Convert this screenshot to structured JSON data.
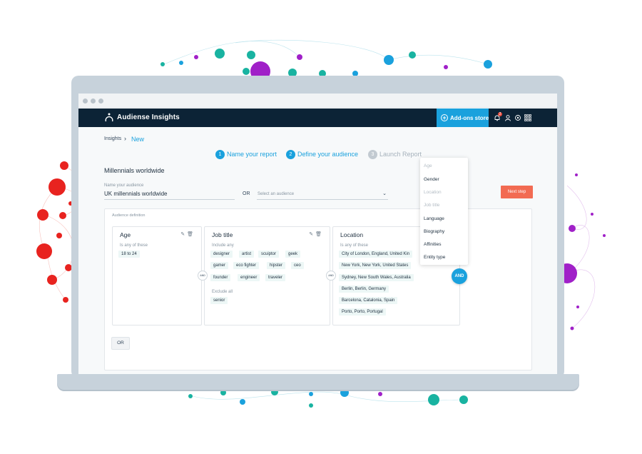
{
  "window": {
    "title": "Audiense Insights"
  },
  "navbar": {
    "brand": "Audiense Insights",
    "addons_label": "Add-ons store",
    "notification_count": "2",
    "icons": [
      "bell-icon",
      "user-icon",
      "settings-icon",
      "apps-grid-icon"
    ]
  },
  "breadcrumb": {
    "root": "Insights",
    "separator": "›",
    "current": "New"
  },
  "steps": [
    {
      "number": "1",
      "label": "Name your report",
      "active": true
    },
    {
      "number": "2",
      "label": "Define your audience",
      "active": true
    },
    {
      "number": "3",
      "label": "Launch Report",
      "active": false
    }
  ],
  "audience": {
    "title": "Millennials worldwide",
    "name_label": "Name your audience",
    "name_value": "UK millennials worldwide",
    "or_label": "OR",
    "select_placeholder": "Select an audience",
    "next_button": "Next step"
  },
  "definition": {
    "label": "Audience definition",
    "and_label": "AND",
    "or_button": "OR",
    "cards": {
      "age": {
        "title": "Age",
        "subtitle": "Is any of these",
        "chips": [
          "18 to 24"
        ]
      },
      "job": {
        "title": "Job title",
        "include_label": "Include any",
        "include": [
          "designer",
          "artist",
          "scuiptor",
          "geek",
          "gamer",
          "eco fighter",
          "hipster",
          "ceo",
          "founder",
          "engineer",
          "traveler"
        ],
        "exclude_label": "Exclude all",
        "exclude": [
          "senior"
        ]
      },
      "location": {
        "title": "Location",
        "subtitle": "Is any of these",
        "chips": [
          "City of London, England, United Kin",
          "New York, New York, United States",
          "Sydney, New South Wales, Australia",
          "Berlin, Berlin, Germany",
          "Barcelona, Catalonia, Spain",
          "Porto, Porto, Portugal"
        ]
      }
    }
  },
  "dropdown": {
    "items": [
      {
        "label": "Age",
        "enabled": false
      },
      {
        "label": "Gender",
        "enabled": true
      },
      {
        "label": "Location",
        "enabled": false
      },
      {
        "label": "Job title",
        "enabled": false
      },
      {
        "label": "Language",
        "enabled": true
      },
      {
        "label": "Biography",
        "enabled": true
      },
      {
        "label": "Affinities",
        "enabled": true
      },
      {
        "label": "Entity type",
        "enabled": true
      }
    ]
  },
  "colors": {
    "accent": "#1aa1dd",
    "navbar": "#0c2336",
    "next_button": "#f26b52",
    "chip_bg": "#edf7f6"
  }
}
